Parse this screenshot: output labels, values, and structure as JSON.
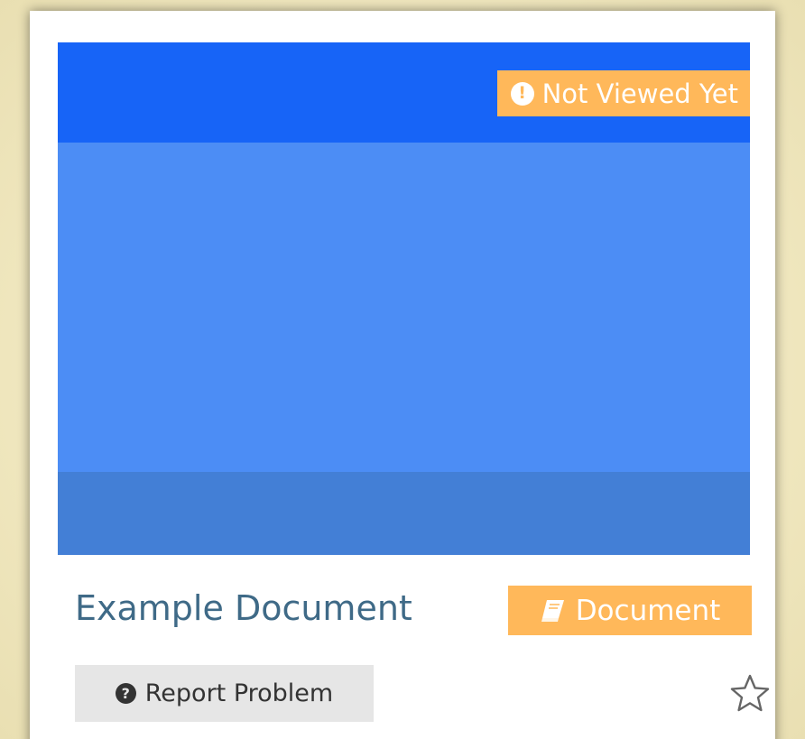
{
  "card": {
    "status_badge": {
      "icon": "exclamation-circle-icon",
      "label": "Not Viewed Yet",
      "color": "#ffb85a"
    },
    "thumbnail": {
      "colors": {
        "top": "#1764f7",
        "middle": "#4c8df5",
        "bottom": "#437fd6"
      }
    },
    "title": "Example Document",
    "type_badge": {
      "icon": "book-icon",
      "label": "Document",
      "color": "#ffb85a"
    },
    "report_button": {
      "icon": "question-circle-icon",
      "label": "Report Problem"
    },
    "favorite": {
      "icon": "star-outline-icon",
      "active": false
    }
  }
}
